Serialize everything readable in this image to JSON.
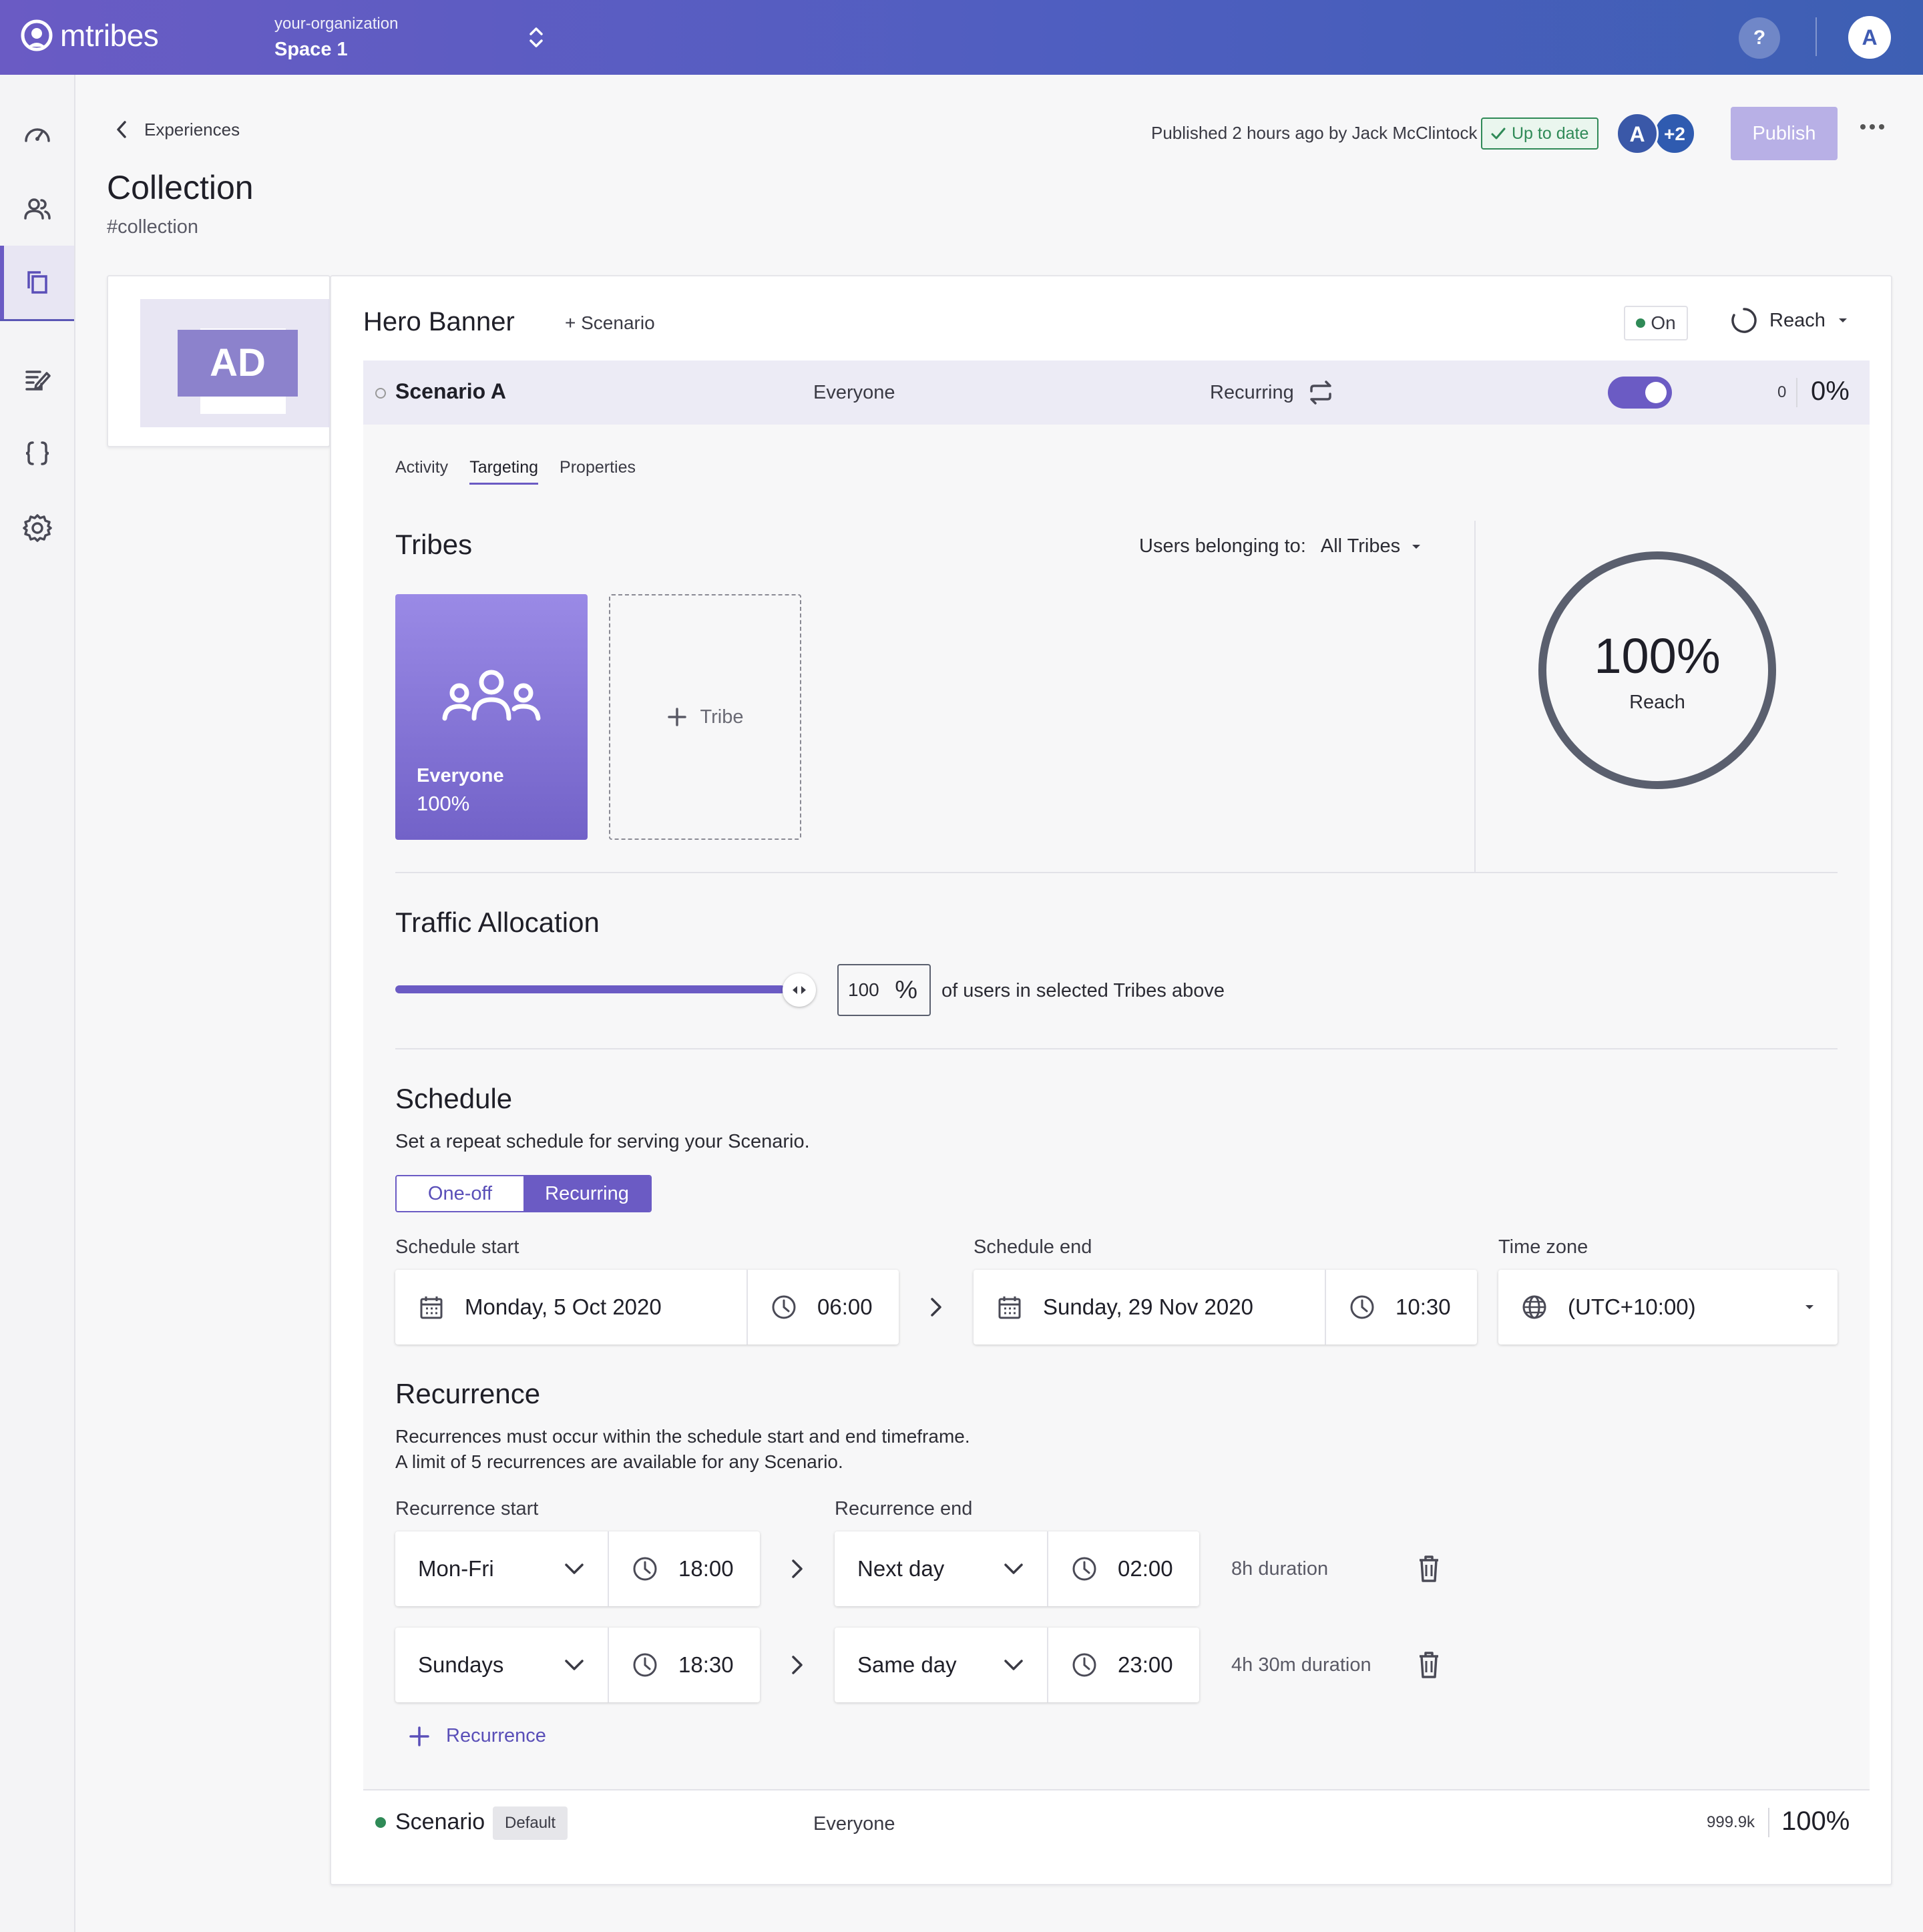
{
  "topbar": {
    "logo_text": "mtribes",
    "org_name": "your-organization",
    "space_name": "Space 1",
    "help_label": "?",
    "user_initial": "A"
  },
  "sidebar": {
    "items": [
      {
        "icon": "dashboard-icon"
      },
      {
        "icon": "users-icon"
      },
      {
        "icon": "collections-icon",
        "active": true
      },
      {
        "icon": "edit-icon"
      },
      {
        "icon": "code-braces-icon"
      },
      {
        "icon": "settings-icon"
      }
    ]
  },
  "header": {
    "breadcrumb": "Experiences",
    "title": "Collection",
    "key": "#collection",
    "published_text": "Published 2 hours ago by Jack McClintock",
    "status_badge": "Up to date",
    "collaborator_initial": "A",
    "collaborator_more": "+2",
    "publish_label": "Publish"
  },
  "thumbnail": {
    "label": "AD"
  },
  "experience": {
    "title": "Hero Banner",
    "add_scenario": "+ Scenario",
    "status": "On",
    "reach_select": "Reach"
  },
  "scenario_a": {
    "name": "Scenario A",
    "tribe": "Everyone",
    "schedule_type": "Recurring",
    "enabled": true,
    "count": "0",
    "percent": "0%"
  },
  "tabs": [
    "Activity",
    "Targeting",
    "Properties"
  ],
  "active_tab": "Targeting",
  "tribes": {
    "title": "Tribes",
    "belong_label": "Users belonging to:",
    "belong_value": "All Tribes",
    "card_name": "Everyone",
    "card_percent": "100%",
    "add_label": "Tribe",
    "reach_value": "100%",
    "reach_label": "Reach"
  },
  "traffic": {
    "title": "Traffic Allocation",
    "value": "100",
    "unit": "%",
    "slider_fraction": 1.0,
    "description": "of users in selected Tribes above"
  },
  "schedule": {
    "title": "Schedule",
    "description": "Set a repeat schedule for serving your Scenario.",
    "options": [
      "One-off",
      "Recurring"
    ],
    "selected": "Recurring",
    "start_label": "Schedule start",
    "start_date": "Monday, 5 Oct 2020",
    "start_time": "06:00",
    "end_label": "Schedule end",
    "end_date": "Sunday, 29 Nov 2020",
    "end_time": "10:30",
    "timezone_label": "Time zone",
    "timezone": "(UTC+10:00)"
  },
  "recurrence": {
    "title": "Recurrence",
    "description_1": "Recurrences must occur within the schedule start and end timeframe.",
    "description_2": "A limit of 5 recurrences are available for any Scenario.",
    "start_label": "Recurrence start",
    "end_label": "Recurrence end",
    "rows": [
      {
        "start_day": "Mon-Fri",
        "start_time": "18:00",
        "end_day": "Next day",
        "end_time": "02:00",
        "duration": "8h duration"
      },
      {
        "start_day": "Sundays",
        "start_time": "18:30",
        "end_day": "Same day",
        "end_time": "23:00",
        "duration": "4h 30m duration"
      }
    ],
    "add_label": "Recurrence"
  },
  "default_scenario": {
    "name": "Scenario",
    "badge": "Default",
    "tribe": "Everyone",
    "count": "999.9k",
    "percent": "100%"
  }
}
